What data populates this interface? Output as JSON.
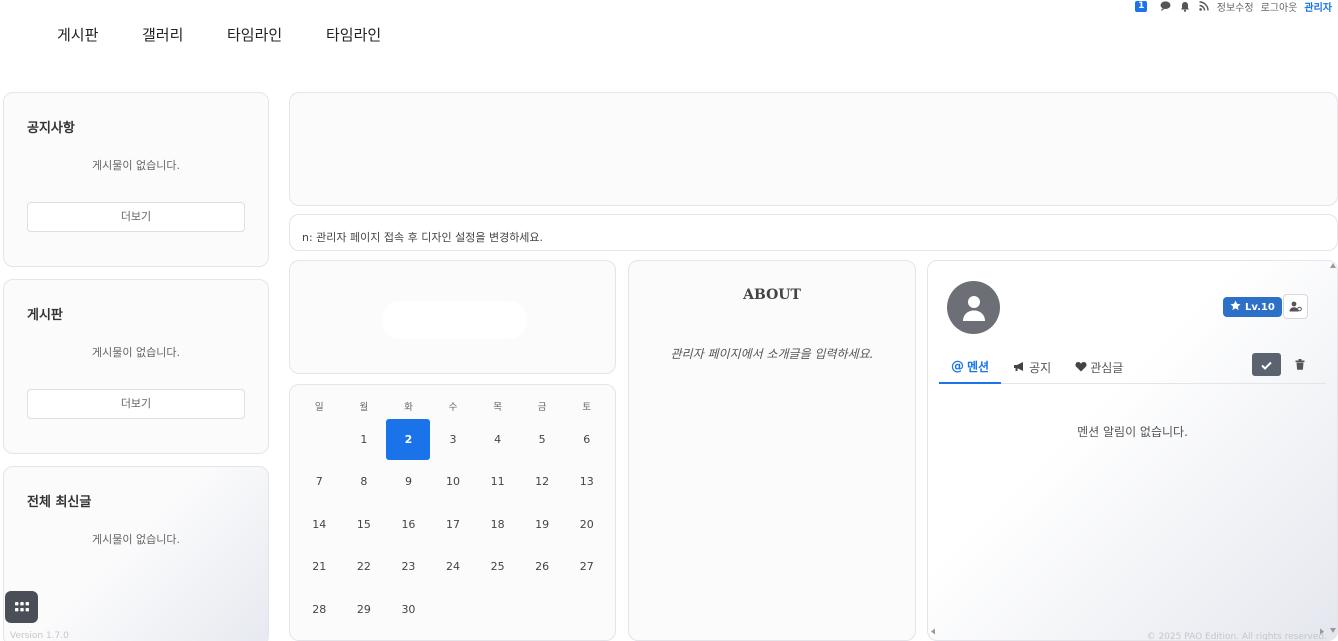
{
  "topbar": {
    "member_badge": "1",
    "edit_info": "정보수정",
    "logout": "로그아웃",
    "admin": "관리자"
  },
  "nav": [
    {
      "label": "게시판"
    },
    {
      "label": "갤러리"
    },
    {
      "label": "타임라인"
    },
    {
      "label": "타임라인"
    }
  ],
  "sidebar": {
    "notice": {
      "title": "공지사항",
      "empty": "게시물이 없습니다.",
      "more": "더보기"
    },
    "board": {
      "title": "게시판",
      "empty": "게시물이 없습니다.",
      "more": "더보기"
    },
    "latest": {
      "title": "전체 최신글",
      "empty": "게시물이 없습니다."
    }
  },
  "notice_bar": {
    "text": "n: 관리자 페이지 접속 후 디자인 설정을 변경하세요."
  },
  "calendar": {
    "weekdays": [
      "일",
      "월",
      "화",
      "수",
      "목",
      "금",
      "토"
    ],
    "weeks": [
      [
        "",
        "1",
        "2",
        "3",
        "4",
        "5",
        "6"
      ],
      [
        "7",
        "8",
        "9",
        "10",
        "11",
        "12",
        "13"
      ],
      [
        "14",
        "15",
        "16",
        "17",
        "18",
        "19",
        "20"
      ],
      [
        "21",
        "22",
        "23",
        "24",
        "25",
        "26",
        "27"
      ],
      [
        "28",
        "29",
        "30",
        "",
        "",
        "",
        ""
      ]
    ],
    "today": "2"
  },
  "about": {
    "title": "ABOUT",
    "text": "관리자 페이지에서 소개글을 입력하세요."
  },
  "profile": {
    "level": "Lv.10",
    "tabs": [
      {
        "label": "멘션",
        "icon": "at-icon"
      },
      {
        "label": "공지",
        "icon": "megaphone-icon"
      },
      {
        "label": "관심글",
        "icon": "heart-icon"
      }
    ],
    "empty": "멘션 알림이 없습니다.",
    "copyright": "© 2025 PAO Edition. All rights reserved."
  },
  "footer": {
    "version": "Version 1.7.0"
  },
  "colors": {
    "accent": "#1a73e8",
    "badge": "#2d70c8",
    "dark_button": "#5c6370"
  }
}
